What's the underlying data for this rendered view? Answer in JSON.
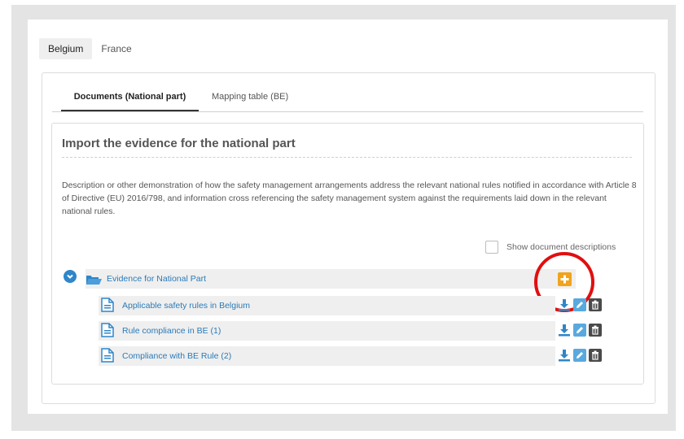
{
  "country_tabs": [
    {
      "label": "Belgium",
      "active": true
    },
    {
      "label": "France",
      "active": false
    }
  ],
  "doc_tabs": [
    {
      "label": "Documents (National part)",
      "active": true
    },
    {
      "label": "Mapping table (BE)",
      "active": false
    }
  ],
  "section": {
    "title": "Import the evidence for the national part",
    "description": "Description or other demonstration of how the safety management arrangements address the relevant national rules notified in accordance with Article 8 of Directive (EU) 2016/798, and information cross referencing the safety management system against the requirements laid down in the relevant national rules."
  },
  "show_descriptions": {
    "label": "Show document descriptions",
    "checked": false
  },
  "folder": {
    "label": "Evidence for National Part",
    "expanded": true,
    "documents": [
      {
        "label": "Applicable safety rules in Belgium"
      },
      {
        "label": "Rule compliance in BE (1)"
      },
      {
        "label": "Compliance with BE Rule (2)"
      }
    ]
  },
  "colors": {
    "link": "#2a7ab8",
    "add_button": "#f0a31b",
    "highlight_circle": "#e10f0f"
  }
}
